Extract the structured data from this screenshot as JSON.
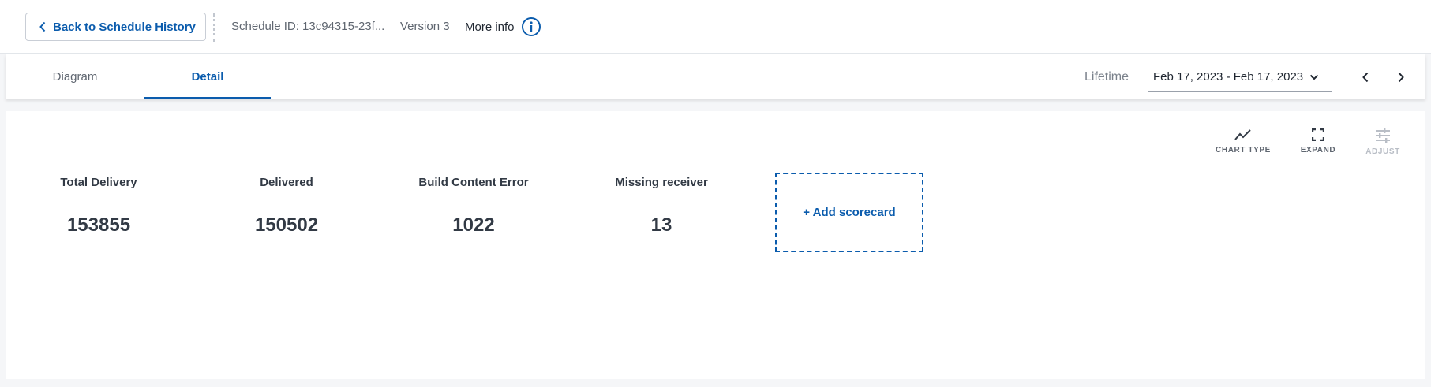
{
  "header": {
    "back_label": "Back to Schedule History",
    "schedule_id": "Schedule ID: 13c94315-23f...",
    "version": "Version 3",
    "more_info_label": "More info"
  },
  "tabs": [
    {
      "label": "Diagram",
      "active": false
    },
    {
      "label": "Detail",
      "active": true
    }
  ],
  "date_range": {
    "period_label": "Lifetime",
    "selected": "Feb 17, 2023 - Feb 17, 2023"
  },
  "toolbar": {
    "chart_type_label": "CHART TYPE",
    "expand_label": "EXPAND",
    "adjust_label": "ADJUST"
  },
  "scorecards": [
    {
      "label": "Total Delivery",
      "value": "153855"
    },
    {
      "label": "Delivered",
      "value": "150502"
    },
    {
      "label": "Build Content Error",
      "value": "1022"
    },
    {
      "label": "Missing receiver",
      "value": "13"
    }
  ],
  "add_scorecard_label": "+ Add scorecard",
  "icons": {
    "back": "chevron-left-icon",
    "info": "info-circle-icon",
    "dropdown": "chevron-down-icon",
    "prev": "chevron-left-icon",
    "next": "chevron-right-icon",
    "chart_type": "line-chart-icon",
    "expand": "expand-icon",
    "adjust": "sliders-icon"
  },
  "colors": {
    "accent": "#0b5cad",
    "text": "#323a45",
    "muted": "#5f6670",
    "disabled": "#b9bec6"
  }
}
